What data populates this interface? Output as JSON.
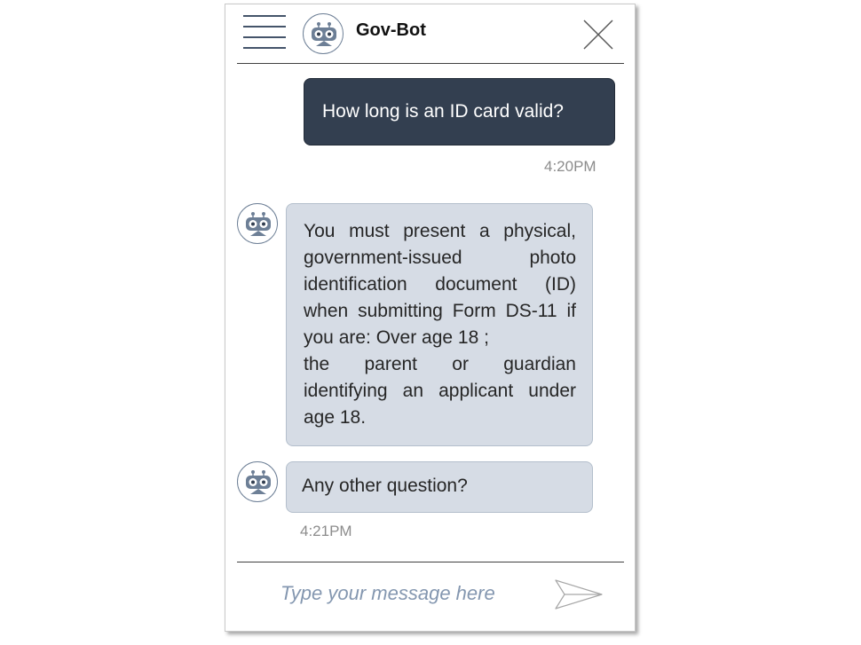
{
  "header": {
    "title": "Gov-Bot",
    "menu_icon": "hamburger-menu-icon",
    "avatar_icon": "robot-icon",
    "close_icon": "close-icon"
  },
  "conversation": {
    "user_message": {
      "text": "How long is an ID card valid?",
      "time": "4:20PM"
    },
    "bot_messages": [
      {
        "paragraphs": [
          "You must present a physical, government-issued photo identification document (ID) when submitting Form DS-11 if you are:  Over age 18 ;",
          "the parent or guardian identifying an applicant under age 18."
        ]
      },
      {
        "text": "Any other question?"
      }
    ],
    "bot_time": "4:21PM"
  },
  "composer": {
    "placeholder": "Type your message here",
    "value": "",
    "send_icon": "send-icon"
  },
  "colors": {
    "user_bubble": "#333f50",
    "bot_bubble": "#d6dce5",
    "accent": "#44546a",
    "timestamp": "#8c8c8c",
    "placeholder": "#8497b0"
  }
}
